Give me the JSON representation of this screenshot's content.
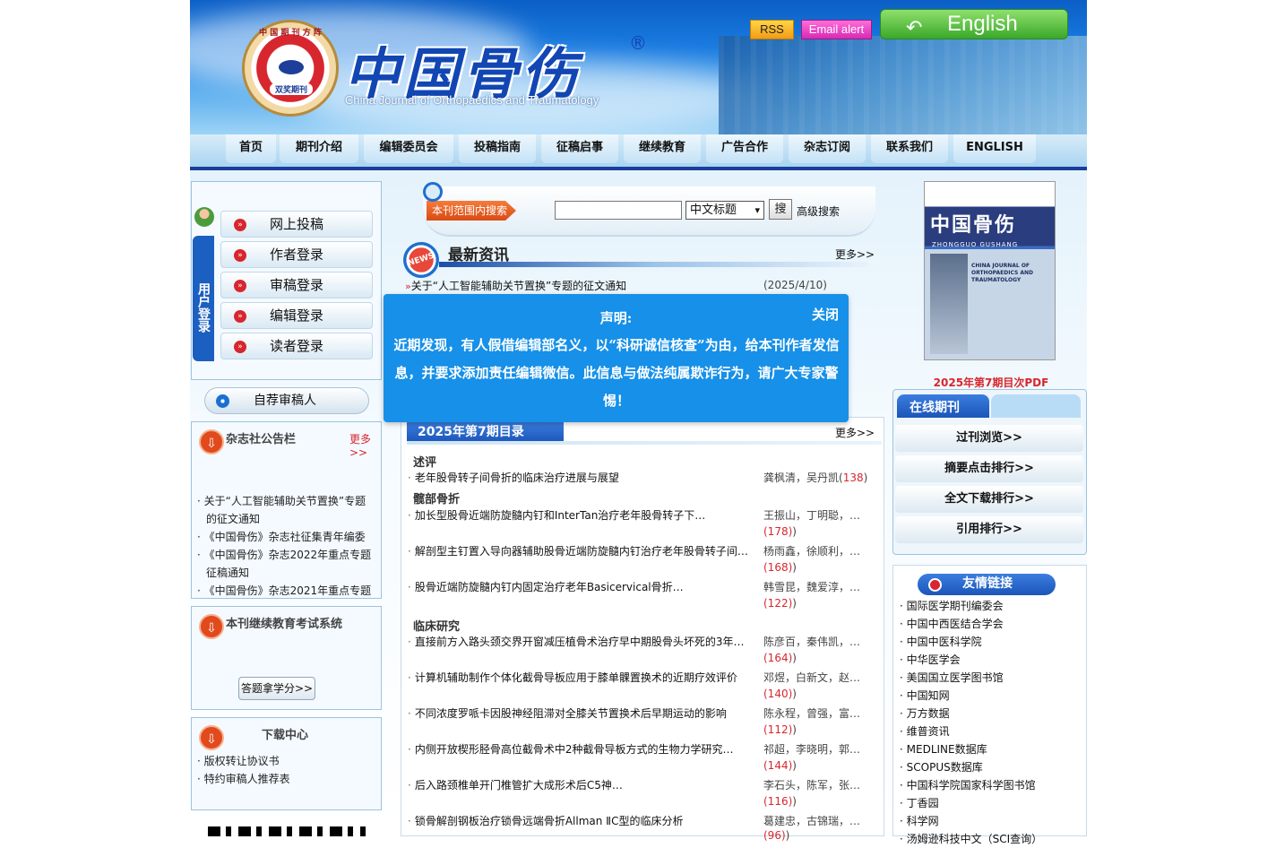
{
  "header": {
    "emblem_ring_text": "中 国 期 刊 方 阵",
    "emblem_award": "双奖期刊",
    "title_cn": "中国骨伤",
    "reg_mark": "®",
    "title_en": "China Journal of Orthopaedics and Traumatology",
    "rss_label": "RSS",
    "email_label": "Email alert",
    "english_label": "English",
    "english_icon": "↶"
  },
  "nav": {
    "items": [
      "首页",
      "期刊介绍",
      "编辑委员会",
      "投稿指南",
      "征稿启事",
      "继续教育",
      "广告合作",
      "杂志订阅",
      "联系我们",
      "ENGLISH"
    ]
  },
  "login": {
    "tab_label": "用户登录",
    "buttons": [
      "网上投稿",
      "作者登录",
      "审稿登录",
      "编辑登录",
      "读者登录"
    ],
    "reviewer": "自荐审稿人"
  },
  "notice": {
    "title": "杂志社公告栏",
    "more": "更多>>",
    "items": [
      "关于“人工智能辅助关节置换”专题的征文通知",
      "《中国骨伤》杂志社征集青年编委",
      "《中国骨伤》杂志2022年重点专题征稿通知",
      "《中国骨伤》杂志2021年重点专题"
    ]
  },
  "education": {
    "title": "本刊继续教育考试系统",
    "button": "答题拿学分>>"
  },
  "download": {
    "title": "下载中心",
    "items": [
      "版权转让协议书",
      "特约审稿人推荐表"
    ]
  },
  "search": {
    "tag": "本刊范围内搜索",
    "input_value": "",
    "select_value": "中文标题",
    "go": "搜",
    "advanced": "高级搜索"
  },
  "news": {
    "badge": "NEWS",
    "title": "最新资讯",
    "more": "更多>>",
    "items": [
      {
        "title": "关于“人工智能辅助关节置换”专题的征文通知",
        "date": "(2025/4/10)"
      }
    ]
  },
  "modal": {
    "heading": "声明:",
    "close": "关闭",
    "body": "近期发现，有人假借编辑部名义，以“科研诚信核查”为由，给本刊作者发信息，并要求添加责任编辑微信。此信息与做法纯属欺诈行为，请广大专家警惕！"
  },
  "toc": {
    "tab": "2025年第7期目录",
    "more": "更多>>",
    "sections": [
      {
        "name": "述评",
        "articles": [
          {
            "title": "老年股骨转子间骨折的临床治疗进展与展望",
            "authors": "龚枫清，吴丹凯(",
            "count": "138",
            "close": ")"
          }
        ]
      },
      {
        "name": "髋部骨折",
        "articles": [
          {
            "title": "加长型股骨近端防旋髓内钉和InterTan治疗老年股骨转子下…",
            "authors": "王振山，丁明聪，…",
            "count": "(178)",
            "close": ")"
          },
          {
            "title": "解剖型主钉置入导向器辅助股骨近端防旋髓内钉治疗老年股骨转子间…",
            "authors": "杨雨鑫，徐顺利，…",
            "count": "(168)",
            "close": ")"
          },
          {
            "title": "股骨近端防旋髓内钉内固定治疗老年Basicervical骨折…",
            "authors": "韩雪昆，魏爱淳，…",
            "count": "(122)",
            "close": ")"
          }
        ]
      },
      {
        "name": "临床研究",
        "articles": [
          {
            "title": "直接前方入路头颈交界开窗减压植骨术治疗早中期股骨头坏死的3年…",
            "authors": "陈彦百，秦伟凯，…",
            "count": "(164)",
            "close": ")"
          },
          {
            "title": "计算机辅助制作个体化截骨导板应用于膝单髁置换术的近期疗效评价",
            "authors": "邓煜，白新文，赵…",
            "count": "(140)",
            "close": ")"
          },
          {
            "title": "不同浓度罗哌卡因股神经阻滞对全膝关节置换术后早期运动的影响",
            "authors": "陈永程，曾强，富…",
            "count": "(112)",
            "close": ")"
          },
          {
            "title": "内侧开放楔形胫骨高位截骨术中2种截骨导板方式的生物力学研究…",
            "authors": "祁超，李晓明，郭…",
            "count": "(144)",
            "close": ")"
          },
          {
            "title": "后入路颈椎单开门椎管扩大成形术后C5神…",
            "authors": "李石头，陈军，张…",
            "count": "(116)",
            "close": ")"
          },
          {
            "title": "锁骨解剖钢板治疗锁骨远端骨折Allman ⅡC型的临床分析",
            "authors": "葛建忠，古锦瑞，…",
            "count": "(96)",
            "close": ")"
          }
        ]
      }
    ]
  },
  "cover": {
    "title": "中国骨伤",
    "subtitle": "ZHONGGUO GUSHANG",
    "lines": [
      "CHINA JOURNAL OF",
      "ORTHOPAEDICS AND",
      "TRAUMATOLOGY"
    ],
    "pdf_link": "2025年第7期目次PDF"
  },
  "online": {
    "tab": "在线期刊",
    "buttons": [
      "过刊浏览>>",
      "摘要点击排行>>",
      "全文下载排行>>",
      "引用排行>>"
    ]
  },
  "links": {
    "title": "友情链接",
    "items": [
      "国际医学期刊编委会",
      "中国中西医结合学会",
      "中国中医科学院",
      "中华医学会",
      "美国国立医学图书馆",
      "中国知网",
      "万方数据",
      "维普资讯",
      "MEDLINE数据库",
      "SCOPUS数据库",
      "中国科学院国家科学图书馆",
      "丁香园",
      "科学网",
      "汤姆逊科技中文（SCI查询）"
    ]
  }
}
